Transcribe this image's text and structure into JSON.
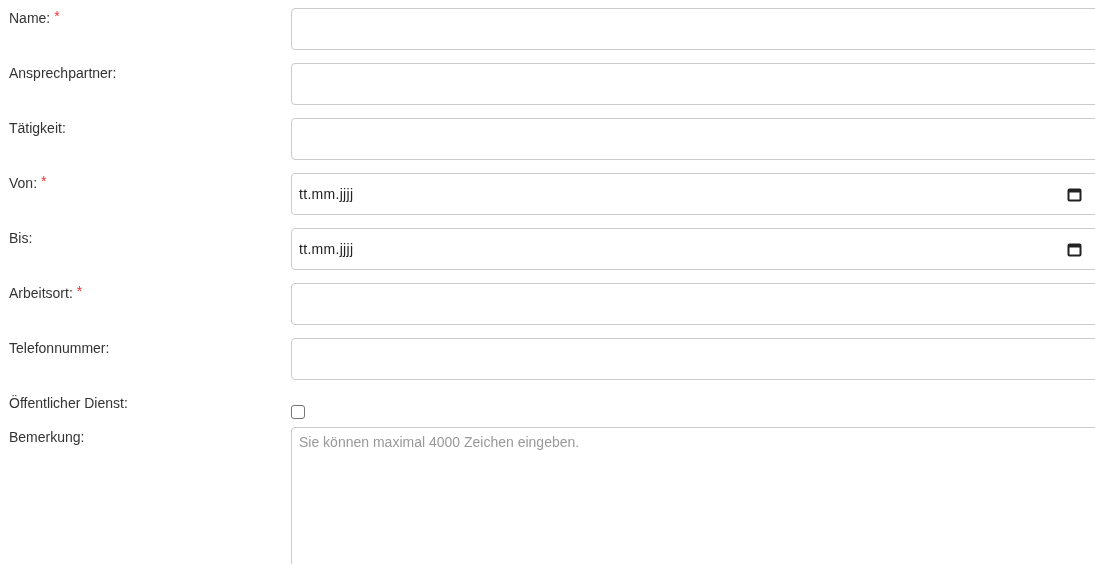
{
  "fields": [
    {
      "label": "Name:",
      "required_mark": "*",
      "kind": "text"
    },
    {
      "label": "Ansprechpartner:",
      "kind": "text"
    },
    {
      "label": "Tätigkeit:",
      "kind": "text"
    },
    {
      "label": "Von:",
      "required_mark": "*",
      "kind": "date",
      "placeholder": "tt.mm.jjjj"
    },
    {
      "label": "Bis:",
      "kind": "date",
      "placeholder": "tt.mm.jjjj"
    },
    {
      "label": "Arbeitsort:",
      "required_mark": "*",
      "kind": "text"
    },
    {
      "label": "Telefonnummer:",
      "kind": "text"
    },
    {
      "label": "Öffentlicher Dienst:",
      "kind": "checkbox",
      "checked": false
    },
    {
      "label": "Bemerkung:",
      "kind": "textarea",
      "placeholder": "Sie können maximal 4000 Zeichen eingeben."
    }
  ]
}
